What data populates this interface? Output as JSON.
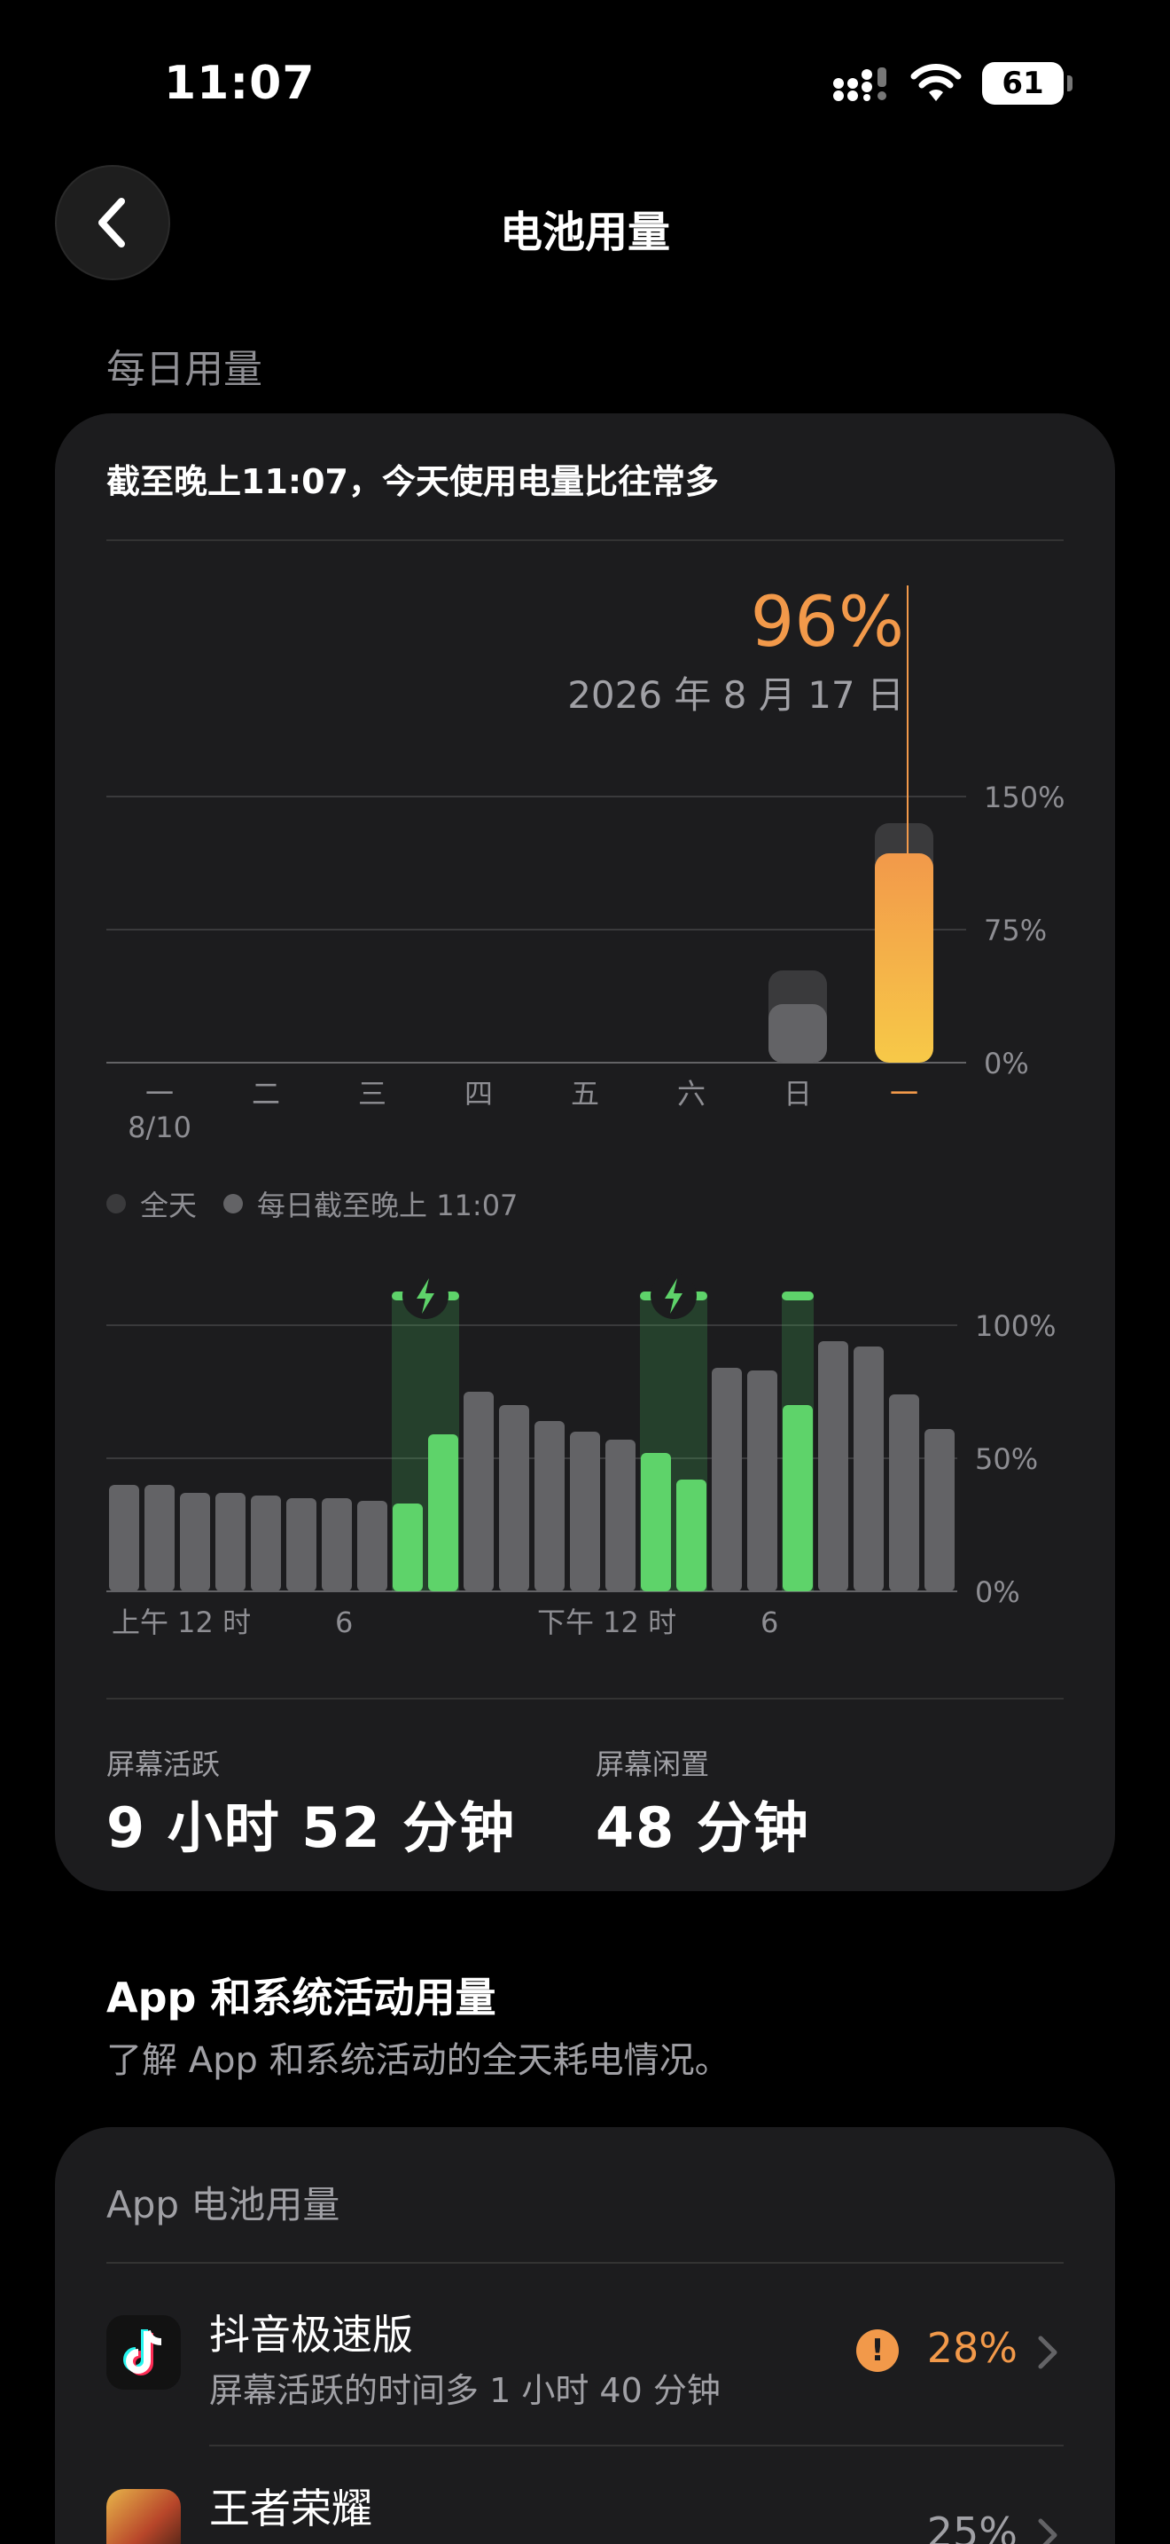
{
  "status": {
    "time": "11:07",
    "battery": "61"
  },
  "nav": {
    "title": "电池用量"
  },
  "daily": {
    "section_label": "每日用量",
    "summary": "截至晚上11:07，今天使用电量比往常多",
    "highlight_value": "96%",
    "highlight_date": "2026 年 8 月 17 日",
    "legend": [
      {
        "label": "全天",
        "color": "#3a3a3c"
      },
      {
        "label": "每日截至晚上 11:07",
        "color": "#636366"
      }
    ]
  },
  "chart_data": [
    {
      "type": "bar",
      "categories": [
        "一",
        "二",
        "三",
        "四",
        "五",
        "六",
        "日",
        "一"
      ],
      "x_sublabel": "8/10",
      "series": [
        {
          "name": "全天",
          "values": [
            0,
            0,
            0,
            0,
            0,
            0,
            52,
            135,
            null
          ]
        },
        {
          "name": "每日截至晚上 11:07",
          "values": [
            0,
            0,
            0,
            0,
            0,
            0,
            33,
            118,
            96
          ]
        }
      ],
      "y_ticks": [
        "150%",
        "75%",
        "0%"
      ],
      "ylim": [
        0,
        150
      ],
      "highlight_index": 7,
      "highlight_color": "#f2994a"
    },
    {
      "type": "bar",
      "x_tick_labels": [
        "上午 12 时",
        "6",
        "下午 12 时",
        "6"
      ],
      "y_ticks": [
        "100%",
        "50%",
        "0%"
      ],
      "ylim": [
        0,
        100
      ],
      "values": [
        40,
        40,
        37,
        37,
        36,
        35,
        35,
        34,
        33,
        59,
        75,
        70,
        64,
        60,
        57,
        52,
        42,
        84,
        83,
        70,
        94,
        92,
        74,
        61
      ],
      "charging": [
        false,
        false,
        false,
        false,
        false,
        false,
        false,
        false,
        true,
        true,
        false,
        false,
        false,
        false,
        false,
        true,
        true,
        false,
        false,
        true,
        false,
        false,
        false,
        false
      ]
    }
  ],
  "screen": {
    "active_label": "屏幕活跃",
    "active_value": "9 小时 52 分钟",
    "idle_label": "屏幕闲置",
    "idle_value": "48 分钟"
  },
  "activity": {
    "title": "App 和系统活动用量",
    "subtitle": "了解 App 和系统活动的全天耗电情况。"
  },
  "apps": {
    "card_title": "App 电池用量",
    "items": [
      {
        "name": "抖音极速版",
        "detail": "屏幕活跃的时间多 1 小时 40 分钟",
        "percent": "28%",
        "warning": true
      },
      {
        "name": "王者荣耀",
        "detail": "",
        "percent": "25%",
        "warning": false
      }
    ]
  }
}
